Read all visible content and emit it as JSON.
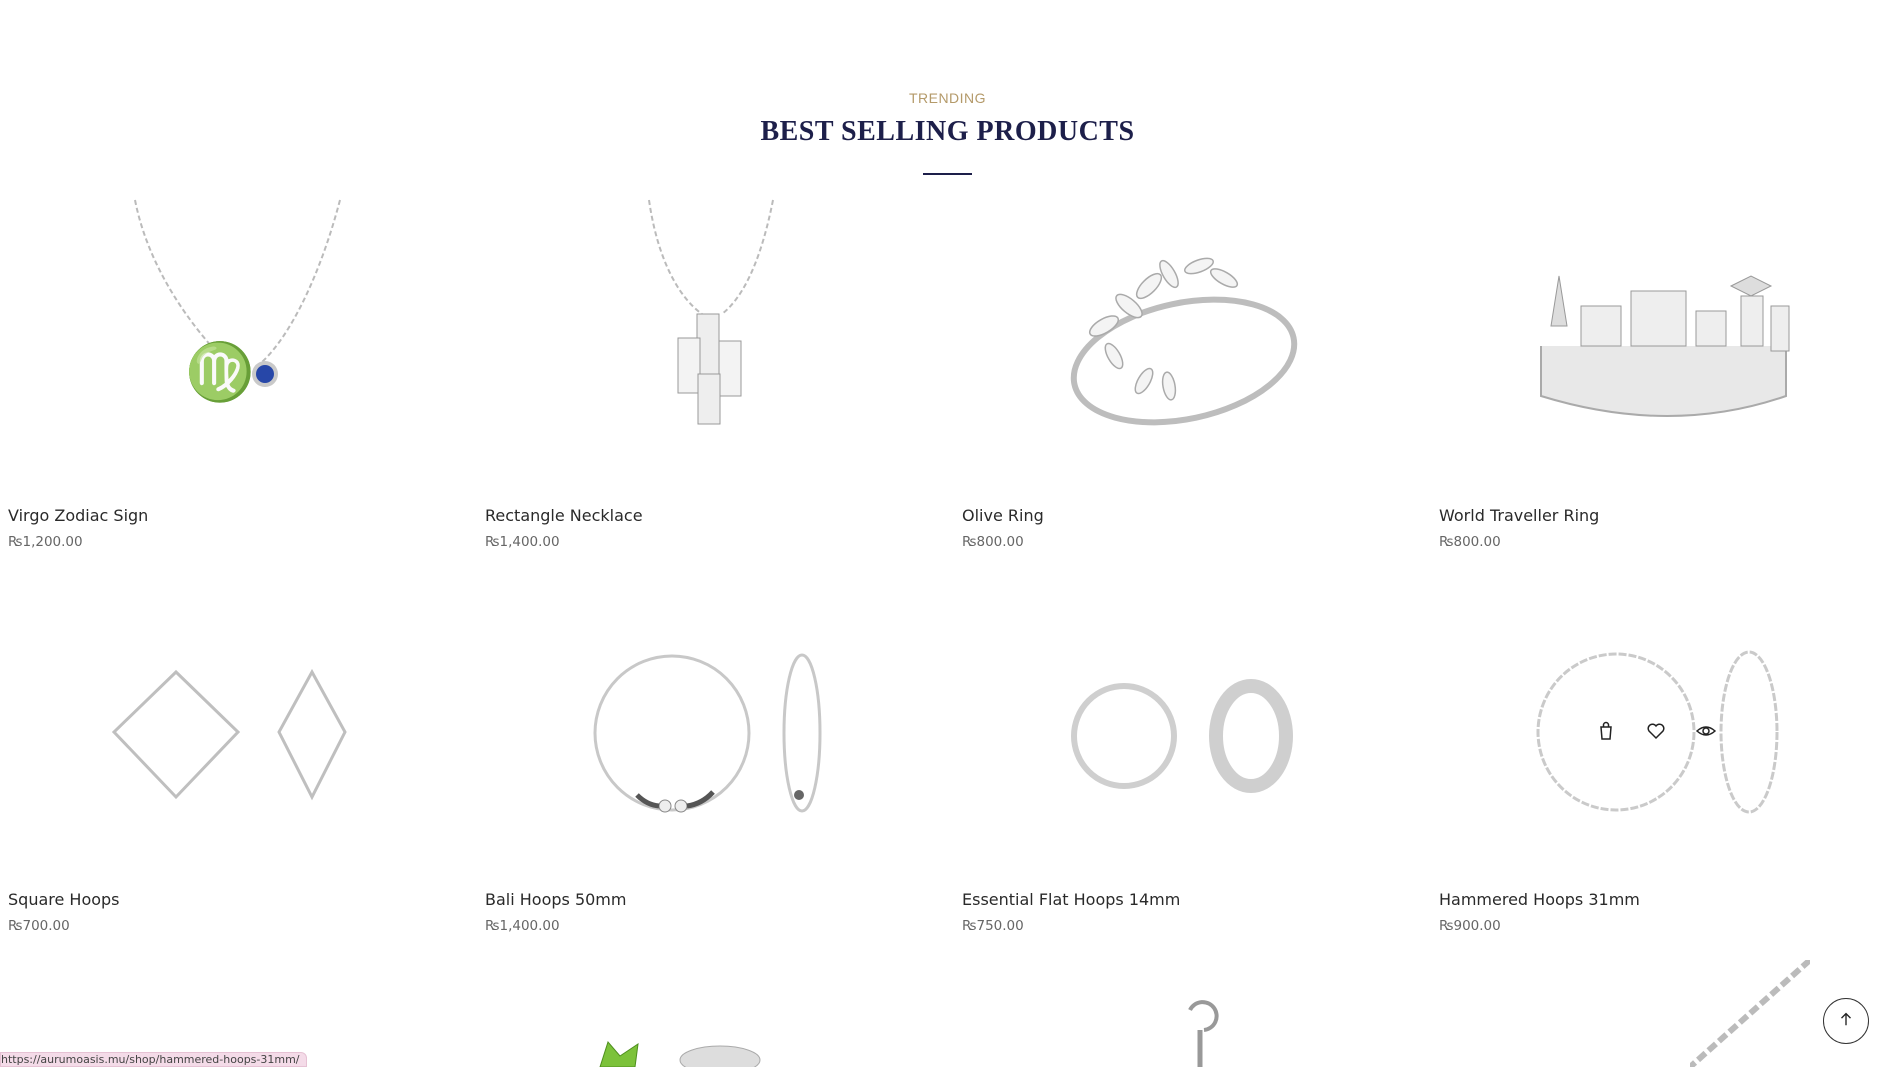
{
  "section": {
    "eyebrow": "TRENDING",
    "title": "BEST SELLING PRODUCTS"
  },
  "products": [
    {
      "name": "Virgo Zodiac Sign",
      "price": "₨1,200.00"
    },
    {
      "name": "Rectangle Necklace",
      "price": "₨1,400.00"
    },
    {
      "name": "Olive Ring",
      "price": "₨800.00"
    },
    {
      "name": "World Traveller Ring",
      "price": "₨800.00"
    },
    {
      "name": "Square Hoops",
      "price": "₨700.00"
    },
    {
      "name": "Bali Hoops 50mm",
      "price": "₨1,400.00"
    },
    {
      "name": "Essential Flat Hoops 14mm",
      "price": "₨750.00"
    },
    {
      "name": "Hammered Hoops 31mm",
      "price": "₨900.00"
    }
  ],
  "hover_actions": {
    "icons": [
      "shopping-bag-icon",
      "heart-icon",
      "eye-icon"
    ]
  },
  "status_bar": {
    "url": "https://aurumoasis.mu/shop/hammered-hoops-31mm/"
  },
  "colors": {
    "eyebrow": "#b49a6a",
    "title": "#1d1f4a",
    "silver": "#c8c8c8",
    "blue_gem": "#2747a8",
    "green_gem": "#7cc23a"
  }
}
